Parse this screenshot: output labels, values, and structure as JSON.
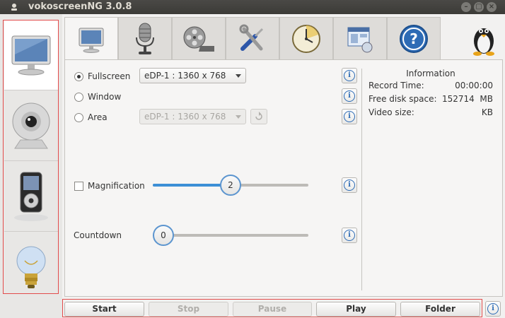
{
  "window": {
    "title": "vokoscreenNG 3.0.8"
  },
  "window_controls": {
    "minimize": "–",
    "maximize": "▢",
    "close": "×"
  },
  "side_tabs": [
    {
      "icon": "monitor-icon",
      "active": true
    },
    {
      "icon": "webcam-icon",
      "active": false
    },
    {
      "icon": "media-player-icon",
      "active": false
    },
    {
      "icon": "lightbulb-icon",
      "active": false
    }
  ],
  "top_tabs": [
    {
      "icon": "monitor-icon",
      "active": true
    },
    {
      "icon": "microphone-icon",
      "active": false
    },
    {
      "icon": "film-reel-icon",
      "active": false
    },
    {
      "icon": "tools-icon",
      "active": false
    },
    {
      "icon": "clock-icon",
      "active": false
    },
    {
      "icon": "window-icon",
      "active": false
    },
    {
      "icon": "help-icon",
      "active": false
    }
  ],
  "capture": {
    "fullscreen_label": "Fullscreen",
    "fullscreen_selected": true,
    "fullscreen_screen": "eDP-1 :  1360 x 768",
    "window_label": "Window",
    "area_label": "Area",
    "area_screen": "eDP-1 :  1360 x 768",
    "help_glyph": "i"
  },
  "magnification": {
    "label": "Magnification",
    "value": "2",
    "level": 0.5,
    "checked": false
  },
  "countdown": {
    "label": "Countdown",
    "value": "0",
    "level": 0
  },
  "information": {
    "title": "Information",
    "record_time_label": "Record Time:",
    "record_time_value": "00:00:00",
    "disk_label": "Free disk space:",
    "disk_value": "152714",
    "disk_unit": "MB",
    "video_size_label": "Video size:",
    "video_size_unit": "KB"
  },
  "buttons": {
    "start": "Start",
    "stop": "Stop",
    "pause": "Pause",
    "play": "Play",
    "folder": "Folder"
  },
  "colors": {
    "accent": "#3d8fd6",
    "highlight_box": "#e24b4b",
    "info_blue": "#2d6bb5"
  }
}
